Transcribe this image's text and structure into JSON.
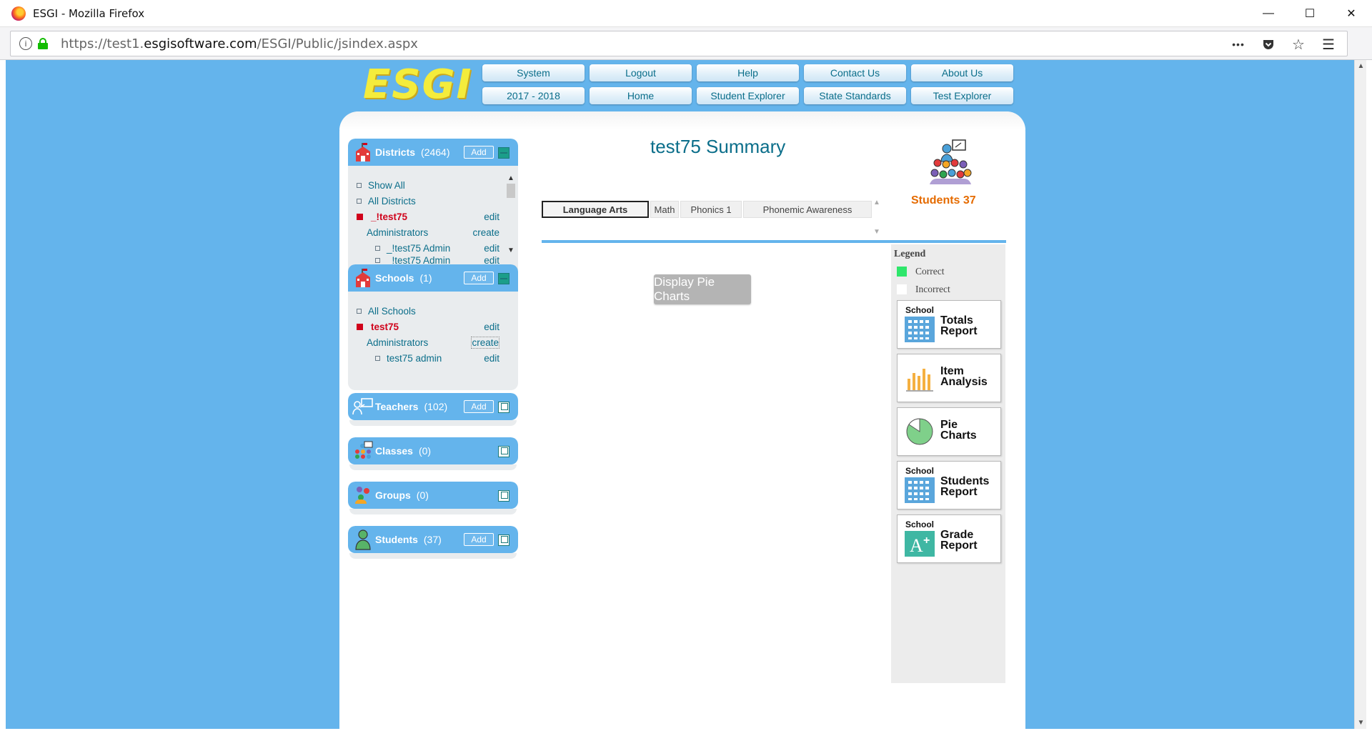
{
  "window": {
    "title": "ESGI - Mozilla Firefox",
    "minimize": "—",
    "maximize": "☐",
    "close": "✕"
  },
  "urlbar": {
    "url_prefix": "https://test1.",
    "url_domain": "esgisoftware.com",
    "url_path": "/ESGI/Public/jsindex.aspx",
    "info_icon": "i",
    "more_icon": "•••",
    "pocket_icon": "pocket-icon",
    "bookmark_icon": "☆",
    "menu_icon": "☰"
  },
  "logo": {
    "text": "ESGI"
  },
  "nav": {
    "row1": [
      "System",
      "Logout",
      "Help",
      "Contact Us",
      "About Us"
    ],
    "row2": [
      "2017 - 2018",
      "Home",
      "Student Explorer",
      "State Standards",
      "Test Explorer"
    ]
  },
  "districts": {
    "title": "Districts",
    "count": "(2464)",
    "add_label": "Add",
    "items": [
      {
        "label": "Show All",
        "action": ""
      },
      {
        "label": "All Districts",
        "action": ""
      },
      {
        "label": "_!test75",
        "action": "edit"
      },
      {
        "label": "Administrators",
        "action": "create"
      },
      {
        "label": "_!test75 Admin",
        "action": "edit"
      },
      {
        "label": "_!test75 Admin",
        "action": "edit"
      }
    ]
  },
  "schools": {
    "title": "Schools",
    "count": "(1)",
    "add_label": "Add",
    "items": [
      {
        "label": "All Schools",
        "action": ""
      },
      {
        "label": "test75",
        "action": "edit"
      },
      {
        "label": "Administrators",
        "action": "create"
      },
      {
        "label": "test75 admin",
        "action": "edit"
      }
    ]
  },
  "teachers": {
    "title": "Teachers",
    "count": "(102)",
    "add_label": "Add"
  },
  "classes": {
    "title": "Classes",
    "count": "(0)"
  },
  "groups": {
    "title": "Groups",
    "count": "(0)"
  },
  "students_panel": {
    "title": "Students",
    "count": "(37)",
    "add_label": "Add"
  },
  "summary": {
    "title": "test75 Summary",
    "students_label": "Students 37"
  },
  "tabs": [
    "Language Arts",
    "Math",
    "Phonics 1",
    "Phonemic Awareness"
  ],
  "active_tab": "Language Arts",
  "display_pie_charts": "Display Pie Charts",
  "legend": {
    "title": "Legend",
    "correct": "Correct",
    "incorrect": "Incorrect",
    "correct_color": "#2ee66b",
    "incorrect_color": "#ffffff"
  },
  "reports": [
    {
      "prefix": "School",
      "line1": "Totals",
      "line2": "Report",
      "icon": "calendar-grid-icon"
    },
    {
      "prefix": "",
      "line1": "Item",
      "line2": "Analysis",
      "icon": "bar-chart-icon"
    },
    {
      "prefix": "",
      "line1": "Pie",
      "line2": "Charts",
      "icon": "pie-chart-icon"
    },
    {
      "prefix": "School",
      "line1": "Students",
      "line2": "Report",
      "icon": "calendar-grid-icon"
    },
    {
      "prefix": "School",
      "line1": "Grade",
      "line2": "Report",
      "icon": "grade-a-plus-icon"
    }
  ],
  "colors": {
    "page_background": "#64b4ec",
    "accent_teal": "#0b6e8a",
    "selected_red": "#d0021b",
    "students_orange": "#e56b00"
  }
}
